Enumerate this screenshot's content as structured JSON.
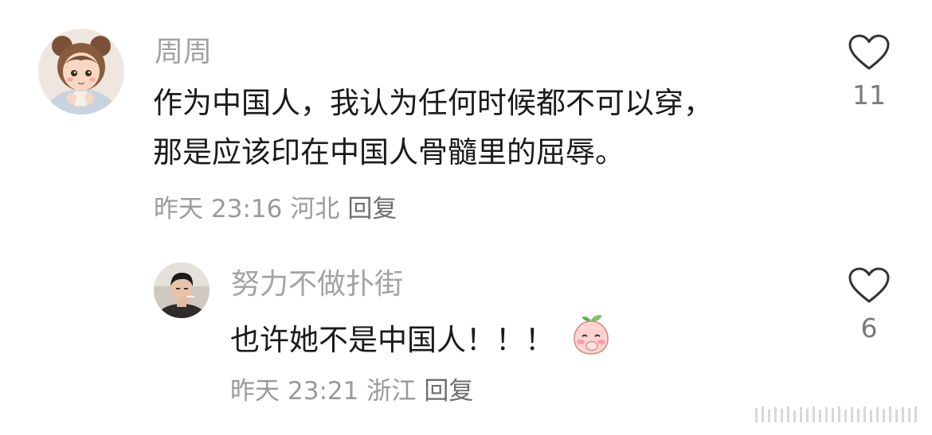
{
  "comments": [
    {
      "username": "周周",
      "content_line1": "作为中国人，我认为任何时候都不可以穿，",
      "content_line2": "那是应该印在中国人骨髓里的屈辱。",
      "date": "昨天",
      "time": "23:16",
      "location": "河北",
      "reply_label": "回复",
      "like_count": "11",
      "avatar_icon": "cartoon-girl-avatar"
    },
    {
      "username": "努力不做扑街",
      "content": "也许她不是中国人！！！",
      "emoji_icon": "shy-peach-emoji",
      "date": "昨天",
      "time": "23:21",
      "location": "浙江",
      "reply_label": "回复",
      "like_count": "6",
      "avatar_icon": "man-photo-avatar"
    }
  ],
  "colors": {
    "username": "#a3a3a3",
    "text": "#1a1a1a",
    "meta": "#9a9a9a",
    "heart_stroke": "#333333"
  }
}
